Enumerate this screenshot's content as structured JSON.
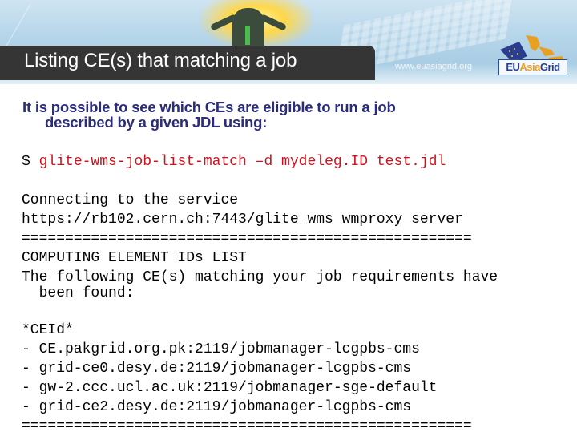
{
  "header": {
    "title": "Listing CE(s) that matching a job",
    "site_url": "www.euasiagrid.org",
    "logo": {
      "eu": "EU",
      "asia": "Asia",
      "grid": "Grid"
    }
  },
  "intro": {
    "line1": "It is possible to see which CEs are eligible to run a job",
    "line2": "described by a given JDL using:"
  },
  "command": {
    "prompt": "$ ",
    "text": "glite-wms-job-list-match –d mydeleg.ID test.jdl"
  },
  "output": {
    "connecting": "Connecting to the service",
    "service_url": "https://rb102.cern.ch:7443/glite_wms_wmproxy_server",
    "separator": "====================================================",
    "list_title": "COMPUTING ELEMENT IDs LIST",
    "found_line1": "The following CE(s) matching your job requirements have",
    "found_line2": "  been found:",
    "ceid_header": "*CEId*",
    "ces": [
      "- CE.pakgrid.org.pk:2119/jobmanager-lcgpbs-cms",
      "- grid-ce0.desy.de:2119/jobmanager-lcgpbs-cms",
      "- gw-2.ccc.ucl.ac.uk:2119/jobmanager-sge-default",
      "- grid-ce2.desy.de:2119/jobmanager-lcgpbs-cms"
    ],
    "end_separator": "===================================================="
  }
}
